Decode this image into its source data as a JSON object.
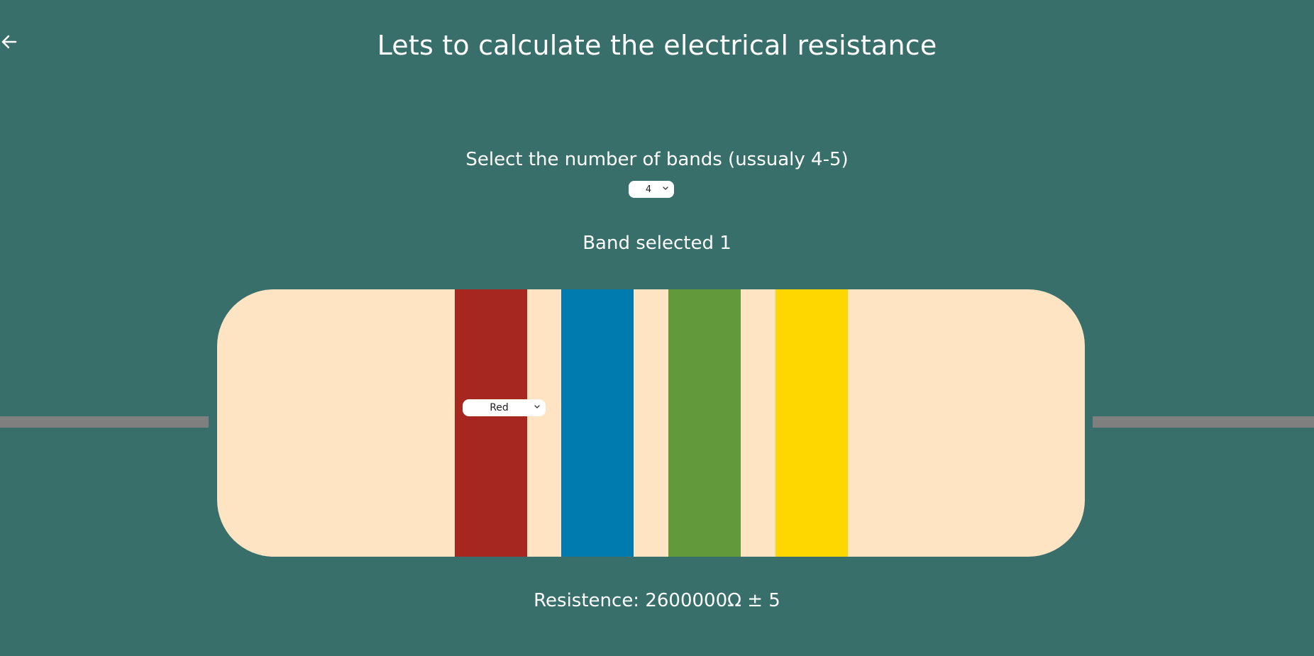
{
  "header": {
    "title": "Lets to calculate the electrical resistance",
    "back_icon": "arrow-left-icon"
  },
  "bands_selector": {
    "label": "Select the number of bands (ussualy 4-5)",
    "value": "4"
  },
  "band_selected": {
    "text": "Band selected 1"
  },
  "resistor": {
    "body_color": "#ffe4c4",
    "lead_color": "#7f7f7f",
    "bands": [
      {
        "color": "#a52720"
      },
      {
        "color": "#007bb0"
      },
      {
        "color": "#62993a"
      },
      {
        "color": "#ffd700"
      }
    ],
    "band_color_select": {
      "value": "Red"
    }
  },
  "result": {
    "text": "Resistence: 2600000Ω ± 5"
  },
  "colors": {
    "background": "#386f6a",
    "text": "#ffffff"
  }
}
